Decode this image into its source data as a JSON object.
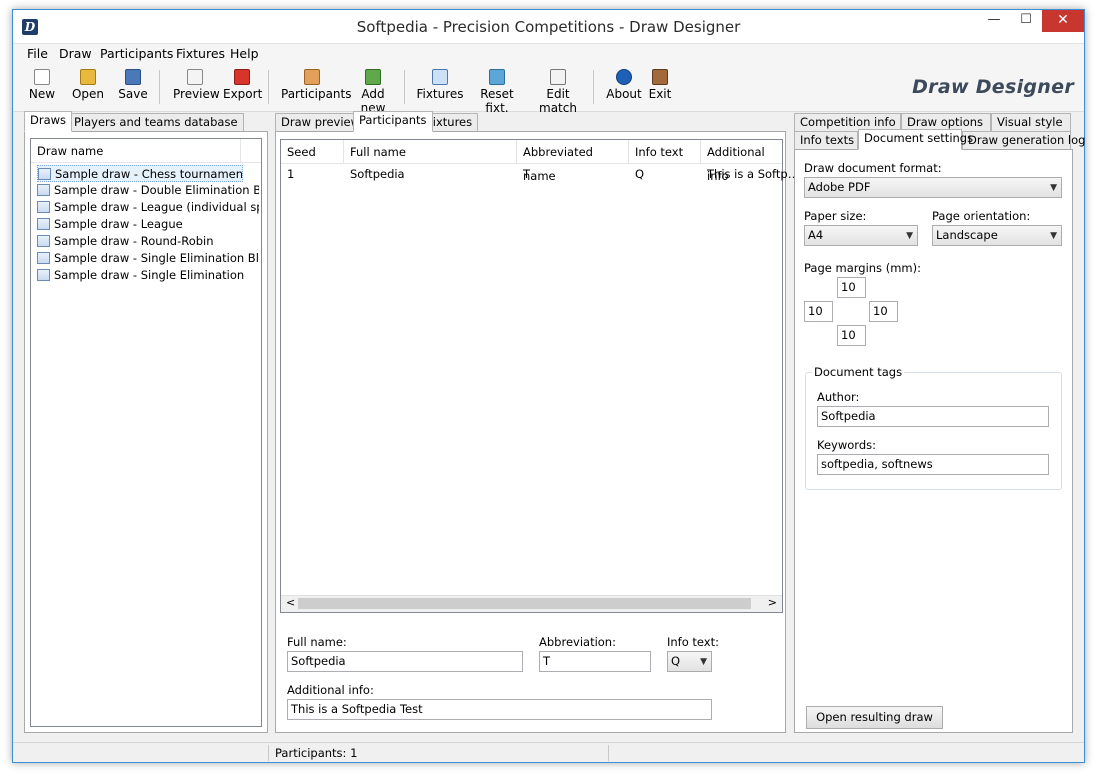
{
  "window": {
    "title": "Softpedia - Precision Competitions - Draw Designer",
    "icon_letter": "D",
    "min_glyph": "—",
    "max_glyph": "☐",
    "close_glyph": "✕"
  },
  "menu": [
    "File",
    "Draw",
    "Participants",
    "Fixtures",
    "Help"
  ],
  "toolbar": {
    "new": "New",
    "open": "Open",
    "save": "Save",
    "preview": "Preview",
    "export": "Export",
    "participants": "Participants",
    "add_new": "Add new",
    "fixtures": "Fixtures",
    "reset_fixt": "Reset fixt.",
    "edit_match": "Edit match",
    "about": "About",
    "exit": "Exit",
    "brand": "Draw Designer"
  },
  "left_panel": {
    "tabs": [
      "Draws",
      "Players and teams database"
    ],
    "list_header": "Draw name",
    "draws": [
      "Sample draw - Chess tournament",
      "Sample draw - Double Elimination Blank",
      "Sample draw - League (individual sp…",
      "Sample draw - League",
      "Sample draw - Round-Robin",
      "Sample draw - Single Elimination Blank",
      "Sample draw - Single Elimination"
    ]
  },
  "center_panel": {
    "tabs": [
      "Draw preview",
      "Participants",
      "Fixtures"
    ],
    "columns": [
      "Seed",
      "Full name",
      "Abbreviated name",
      "Info text",
      "Additional info"
    ],
    "rows": [
      {
        "seed": "1",
        "full_name": "Softpedia",
        "abbrev": "T",
        "info": "Q",
        "additional": "This is a Softp…"
      }
    ],
    "scroll_left": "<",
    "scroll_right": ">",
    "form": {
      "full_name_label": "Full name:",
      "full_name_value": "Softpedia",
      "abbreviation_label": "Abbreviation:",
      "abbreviation_value": "T",
      "info_text_label": "Info text:",
      "info_text_value": "Q",
      "additional_info_label": "Additional info:",
      "additional_info_value": "This is a Softpedia Test"
    }
  },
  "right_panel": {
    "tabs_row1": [
      "Competition info",
      "Draw options",
      "Visual style"
    ],
    "tabs_row2": [
      "Info texts",
      "Document settings",
      "Draw generation log"
    ],
    "format_label": "Draw document format:",
    "format_value": "Adobe PDF",
    "paper_label": "Paper size:",
    "paper_value": "A4",
    "orientation_label": "Page orientation:",
    "orientation_value": "Landscape",
    "margins_label": "Page margins (mm):",
    "margin_top": "10",
    "margin_left": "10",
    "margin_right": "10",
    "margin_bottom": "10",
    "tags_group": "Document tags",
    "author_label": "Author:",
    "author_value": "Softpedia",
    "keywords_label": "Keywords:",
    "keywords_value": "softpedia, softnews",
    "open_button": "Open resulting draw"
  },
  "status": {
    "participants": "Participants: 1"
  },
  "colors": {
    "window_border": "#3b8fd6",
    "close_button": "#c7372f",
    "brand_text": "#3d4a5c"
  },
  "icons": {
    "new": "new-document-icon",
    "open": "open-folder-icon",
    "save": "floppy-save-icon",
    "preview": "preview-icon",
    "export": "pdf-export-icon",
    "participants": "people-icon",
    "add_new": "add-person-icon",
    "fixtures": "grid-fixtures-icon",
    "reset_fixt": "reset-icon",
    "edit_match": "edit-match-icon",
    "about": "info-icon",
    "exit": "exit-door-icon"
  }
}
